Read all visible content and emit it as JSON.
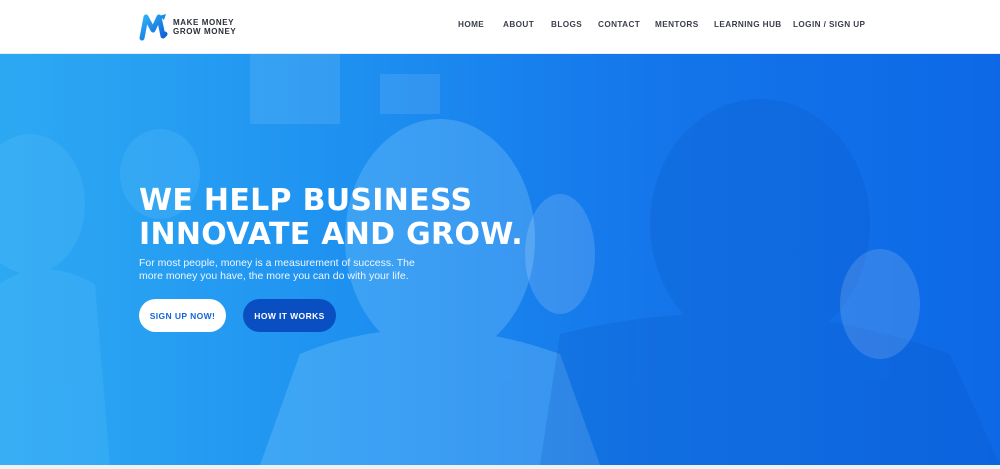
{
  "brand": {
    "name_line1": "MAKE MONEY",
    "name_line2": "GROW MONEY",
    "logo_icon": "m-logo-icon"
  },
  "nav": {
    "items": [
      {
        "label": "HOME"
      },
      {
        "label": "ABOUT"
      },
      {
        "label": "BLOGS"
      },
      {
        "label": "CONTACT"
      },
      {
        "label": "MENTORS"
      },
      {
        "label": "LEARNING HUB"
      },
      {
        "label": "LOGIN / SIGN UP"
      }
    ]
  },
  "hero": {
    "title_line1": "WE HELP BUSINESS",
    "title_line2": "INNOVATE AND GROW.",
    "subtitle": "For most people, money is a measurement of success. The more money you have, the more you can do with your life.",
    "primary_button": "SIGN UP NOW!",
    "secondary_button": "HOW IT WORKS"
  },
  "colors": {
    "accent": "#1576ea",
    "hero_gradient_start": "#2fa8f2",
    "hero_gradient_end": "#0e6ae6",
    "secondary_button": "#0a4fc2",
    "nav_text": "#3b3f4a"
  }
}
